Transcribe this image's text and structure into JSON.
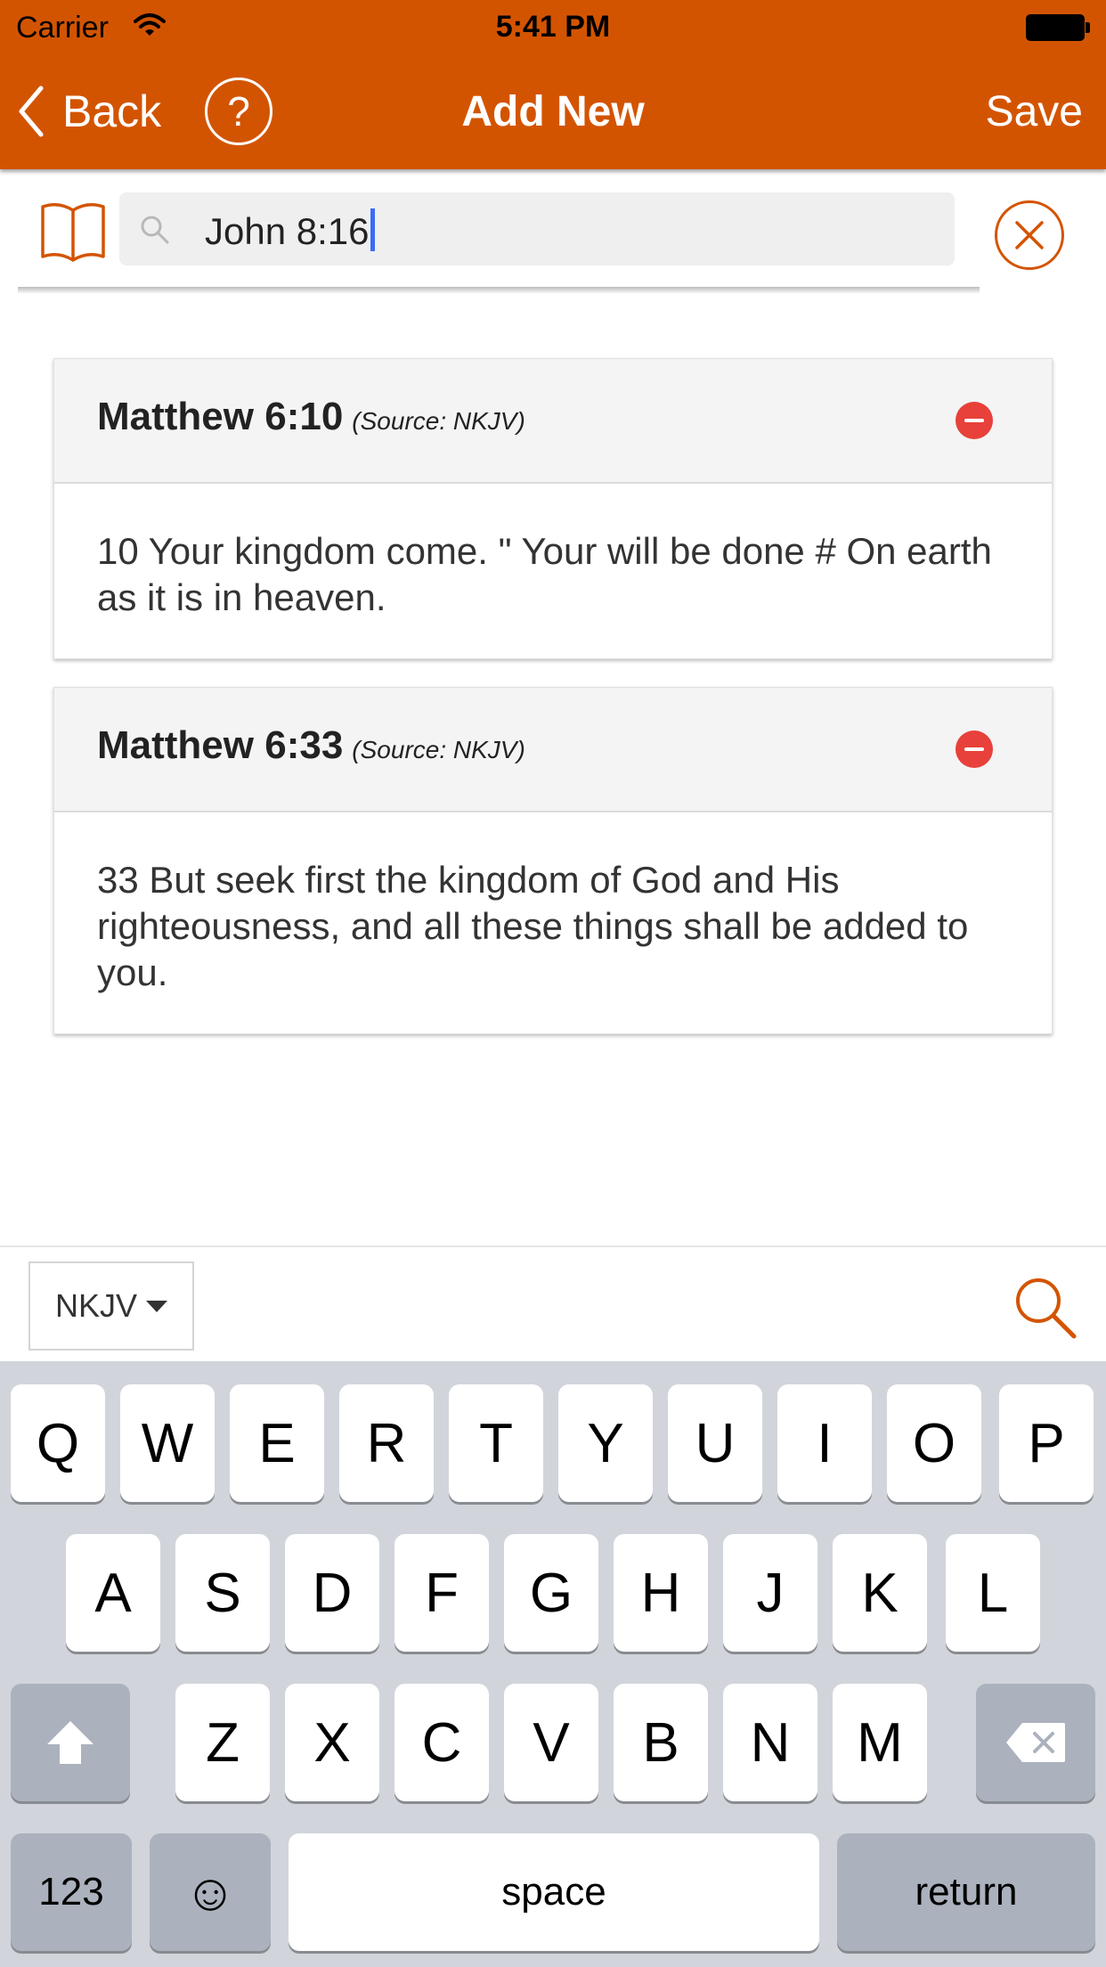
{
  "status_bar": {
    "carrier": "Carrier",
    "time": "5:41 PM"
  },
  "nav": {
    "back_label": "Back",
    "help_label": "?",
    "title": "Add New",
    "save_label": "Save",
    "background_color": "#d35400"
  },
  "search": {
    "value": "John 8:16"
  },
  "verses": [
    {
      "reference": "Matthew 6:10",
      "source": "(Source: NKJV)",
      "text": "10 Your kingdom come. \" Your will be done # On earth as it is in heaven."
    },
    {
      "reference": "Matthew 6:33",
      "source": "(Source: NKJV)",
      "text": "33 But seek first the kingdom of God and His righteousness, and all these things shall be added to you."
    }
  ],
  "accessory": {
    "version": "NKJV"
  },
  "keyboard": {
    "row1": [
      "Q",
      "W",
      "E",
      "R",
      "T",
      "Y",
      "U",
      "I",
      "O",
      "P"
    ],
    "row2": [
      "A",
      "S",
      "D",
      "F",
      "G",
      "H",
      "J",
      "K",
      "L"
    ],
    "row3": [
      "Z",
      "X",
      "C",
      "V",
      "B",
      "N",
      "M"
    ],
    "numbers_label": "123",
    "emoji_label": "☺",
    "space_label": "space",
    "return_label": "return"
  }
}
